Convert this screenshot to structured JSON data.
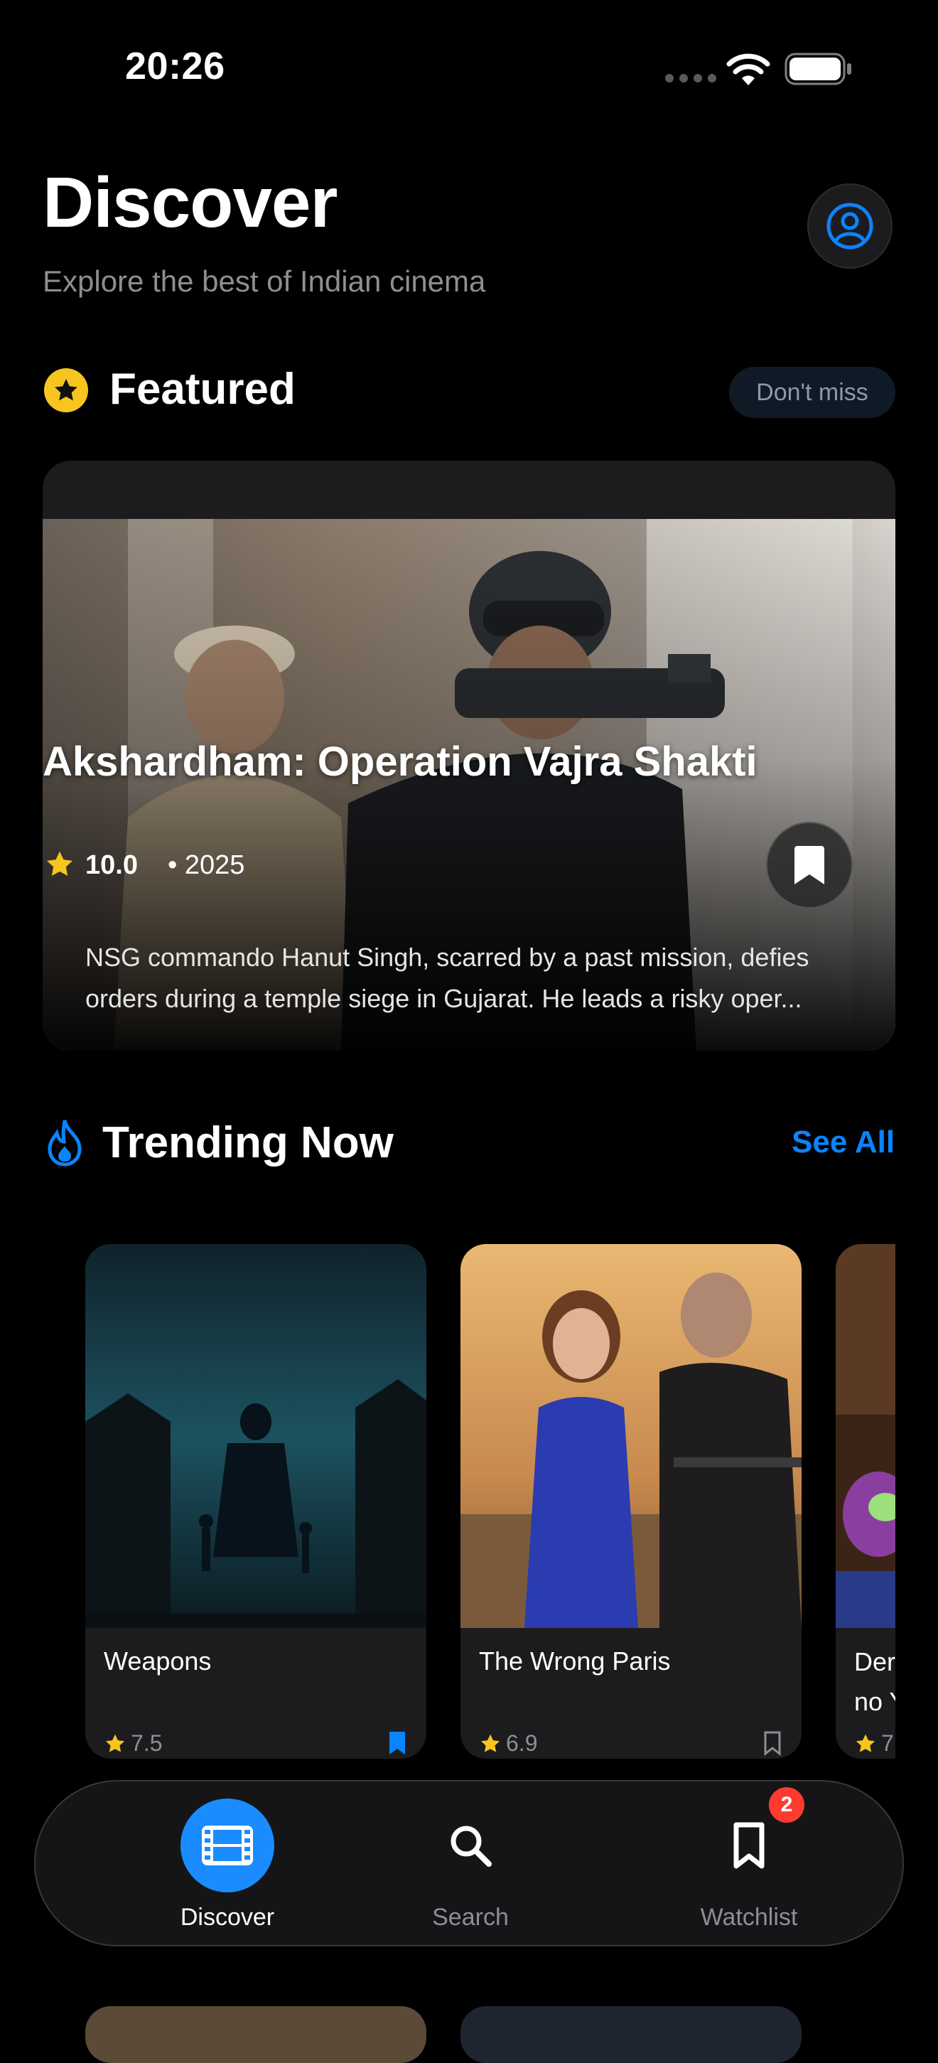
{
  "status_bar": {
    "time": "20:26"
  },
  "header": {
    "title": "Discover",
    "subtitle": "Explore the best of Indian cinema"
  },
  "featured": {
    "section_title": "Featured",
    "badge": "Don't miss",
    "movie": {
      "title": "Akshardham: Operation Vajra Shakti",
      "rating": "10.0",
      "year": "• 2025",
      "description": "NSG commando Hanut Singh, scarred by a past mission, defies orders during a temple siege in Gujarat. He leads a risky oper..."
    }
  },
  "trending": {
    "section_title": "Trending Now",
    "see_all": "See All",
    "items": [
      {
        "title": "Weapons",
        "rating": "7.5",
        "bookmarked": true
      },
      {
        "title": "The Wrong Paris",
        "rating": "6.9",
        "bookmarked": false
      },
      {
        "title": "Der\nno Y",
        "rating": "7",
        "bookmarked": false
      }
    ]
  },
  "tabbar": {
    "tabs": [
      {
        "label": "Discover",
        "icon": "film-icon",
        "active": true
      },
      {
        "label": "Search",
        "icon": "search-icon",
        "active": false
      },
      {
        "label": "Watchlist",
        "icon": "bookmark-icon",
        "active": false
      }
    ],
    "watchlist_badge": "2"
  },
  "colors": {
    "accent": "#0a84ff",
    "star": "#f7c51e",
    "badge": "#ff3b30",
    "background": "#000000",
    "card": "#1c1c1e"
  }
}
